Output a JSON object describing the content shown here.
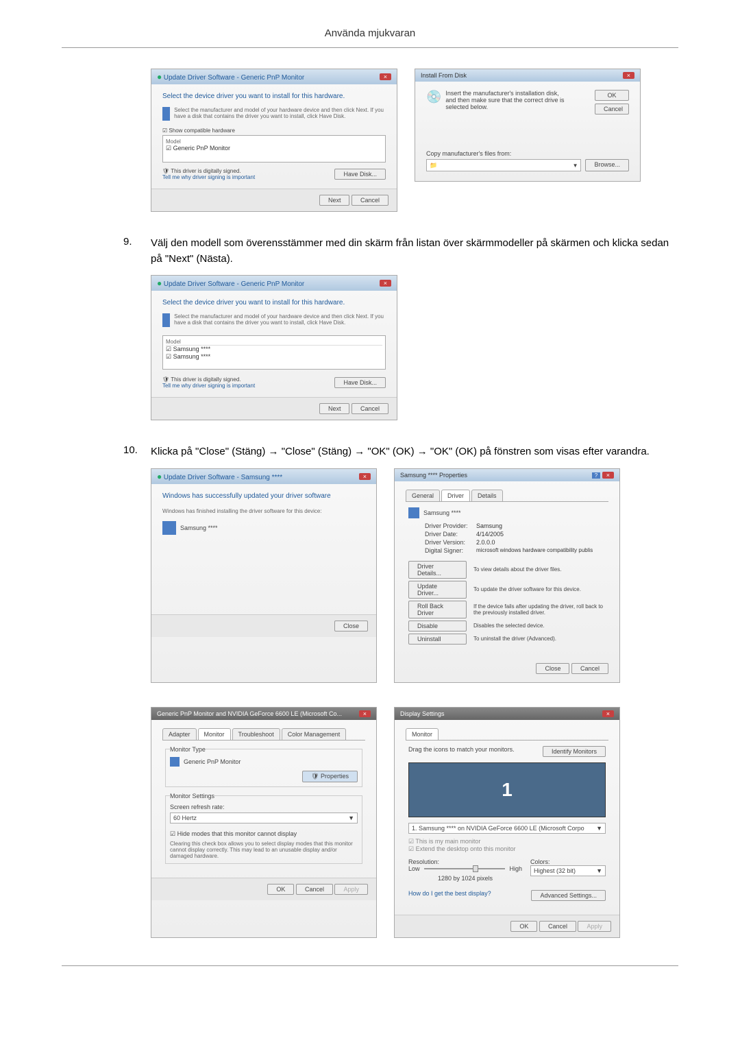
{
  "page": {
    "header": "Använda mjukvaran"
  },
  "step9": {
    "number": "9.",
    "text": "Välj den modell som överensstämmer med din skärm från listan över skärmmodeller på skärmen och klicka sedan på \"Next\" (Nästa)."
  },
  "step10": {
    "number": "10.",
    "text": "Klicka på \"Close\" (Stäng) → \"Close\" (Stäng) → \"OK\" (OK) → \"OK\" (OK) på fönstren som visas efter varandra."
  },
  "dialog1": {
    "title": "Update Driver Software - Generic PnP Monitor",
    "heading": "Select the device driver you want to install for this hardware.",
    "hint": "Select the manufacturer and model of your hardware device and then click Next. If you have a disk that contains the driver you want to install, click Have Disk.",
    "compat": "Show compatible hardware",
    "model_label": "Model",
    "item1": "Generic PnP Monitor",
    "signed": "This driver is digitally signed.",
    "tell": "Tell me why driver signing is important",
    "have_disk": "Have Disk...",
    "next": "Next",
    "cancel": "Cancel"
  },
  "dialog2": {
    "title": "Install From Disk",
    "text": "Insert the manufacturer's installation disk, and then make sure that the correct drive is selected below.",
    "ok": "OK",
    "cancel": "Cancel",
    "copy_label": "Copy manufacturer's files from:",
    "browse": "Browse..."
  },
  "dialog3": {
    "title": "Update Driver Software - Generic PnP Monitor",
    "heading": "Select the device driver you want to install for this hardware.",
    "hint": "Select the manufacturer and model of your hardware device and then click Next. If you have a disk that contains the driver you want to install, click Have Disk.",
    "model_label": "Model",
    "item1": "Samsung ****",
    "item2": "Samsung ****",
    "signed": "This driver is digitally signed.",
    "tell": "Tell me why driver signing is important",
    "have_disk": "Have Disk...",
    "next": "Next",
    "cancel": "Cancel"
  },
  "dialog4": {
    "title": "Update Driver Software - Samsung ****",
    "heading": "Windows has successfully updated your driver software",
    "sub": "Windows has finished installing the driver software for this device:",
    "device": "Samsung ****",
    "close": "Close"
  },
  "dialog5": {
    "title": "Samsung **** Properties",
    "tabs": {
      "general": "General",
      "driver": "Driver",
      "details": "Details"
    },
    "device_name": "Samsung ****",
    "provider_label": "Driver Provider:",
    "provider": "Samsung",
    "date_label": "Driver Date:",
    "date": "4/14/2005",
    "version_label": "Driver Version:",
    "version": "2.0.0.0",
    "signer_label": "Digital Signer:",
    "signer": "microsoft windows hardware compatibility publis",
    "details_btn": "Driver Details...",
    "details_txt": "To view details about the driver files.",
    "update_btn": "Update Driver...",
    "update_txt": "To update the driver software for this device.",
    "rollback_btn": "Roll Back Driver",
    "rollback_txt": "If the device fails after updating the driver, roll back to the previously installed driver.",
    "disable_btn": "Disable",
    "disable_txt": "Disables the selected device.",
    "uninstall_btn": "Uninstall",
    "uninstall_txt": "To uninstall the driver (Advanced).",
    "close": "Close",
    "cancel": "Cancel"
  },
  "dialog6": {
    "title": "Generic PnP Monitor and NVIDIA GeForce 6600 LE (Microsoft Co...",
    "tabs": {
      "adapter": "Adapter",
      "monitor": "Monitor",
      "troubleshoot": "Troubleshoot",
      "color": "Color Management"
    },
    "group1": "Monitor Type",
    "mtype": "Generic PnP Monitor",
    "props_btn": "Properties",
    "group2": "Monitor Settings",
    "refresh_label": "Screen refresh rate:",
    "refresh_val": "60 Hertz",
    "hide": "Hide modes that this monitor cannot display",
    "hide_desc": "Clearing this check box allows you to select display modes that this monitor cannot display correctly. This may lead to an unusable display and/or damaged hardware.",
    "ok": "OK",
    "cancel": "Cancel",
    "apply": "Apply"
  },
  "dialog7": {
    "title": "Display Settings",
    "tab": "Monitor",
    "drag": "Drag the icons to match your monitors.",
    "identify": "Identify Monitors",
    "monitor_num": "1",
    "device": "1. Samsung **** on NVIDIA GeForce 6600 LE (Microsoft Corpo",
    "main": "This is my main monitor",
    "extend": "Extend the desktop onto this monitor",
    "res_label": "Resolution:",
    "low": "Low",
    "high": "High",
    "res_val": "1280 by 1024 pixels",
    "colors_label": "Colors:",
    "colors_val": "Highest (32 bit)",
    "help": "How do I get the best display?",
    "advanced": "Advanced Settings...",
    "ok": "OK",
    "cancel": "Cancel",
    "apply": "Apply"
  }
}
